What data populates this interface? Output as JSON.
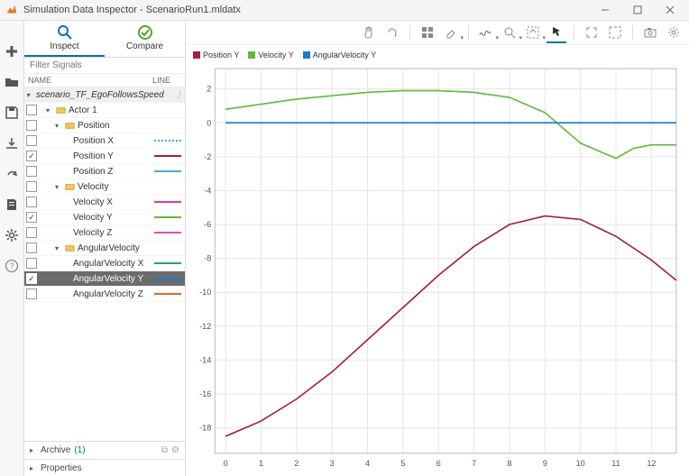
{
  "window": {
    "title": "Simulation Data Inspector - ScenarioRun1.mldatx"
  },
  "tabs": {
    "inspect": "Inspect",
    "compare": "Compare"
  },
  "filter_placeholder": "Filter Signals",
  "columns": {
    "name": "NAME",
    "line": "LINE"
  },
  "scenario": "scenario_TF_EgoFollowsSpeed",
  "actor": "Actor 1",
  "groups": {
    "position": "Position",
    "velocity": "Velocity",
    "angvel": "AngularVelocity"
  },
  "signals": {
    "px": "Position X",
    "py": "Position Y",
    "pz": "Position Z",
    "vx": "Velocity X",
    "vy": "Velocity Y",
    "vz": "Velocity Z",
    "ax": "AngularVelocity X",
    "ay": "AngularVelocity Y",
    "az": "AngularVelocity Z"
  },
  "archive": {
    "label": "Archive",
    "count": "(1)"
  },
  "properties": "Properties",
  "legend": {
    "py": "Position Y",
    "vy": "Velocity Y",
    "ay": "AngularVelocity Y"
  },
  "colors": {
    "py": "#a1203a",
    "vy": "#61b840",
    "ay": "#1f77d4",
    "px": "#4aa8d8",
    "pz": "#4aa8d8",
    "vx": "#c63fc6",
    "vz": "#e04fb8",
    "ax": "#2e9e6e",
    "az": "#e06a2a"
  },
  "chart_data": {
    "type": "line",
    "xlim": [
      -0.3,
      12.7
    ],
    "ylim": [
      -19.5,
      3.2
    ],
    "xticks": [
      0,
      1,
      2,
      3,
      4,
      5,
      6,
      7,
      8,
      9,
      10,
      11,
      12
    ],
    "yticks": [
      2,
      0,
      -2,
      -4,
      -6,
      -8,
      -10,
      -12,
      -14,
      -16,
      -18
    ],
    "series": [
      {
        "name": "Position Y",
        "color": "#a1203a",
        "x": [
          0,
          1,
          2,
          3,
          4,
          5,
          6,
          7,
          8,
          9,
          10,
          11,
          12,
          12.7
        ],
        "y": [
          -18.5,
          -17.6,
          -16.3,
          -14.7,
          -12.8,
          -10.9,
          -9.0,
          -7.3,
          -6.0,
          -5.5,
          -5.7,
          -6.7,
          -8.1,
          -9.3
        ]
      },
      {
        "name": "Velocity Y",
        "color": "#61b840",
        "x": [
          0,
          1,
          2,
          3,
          4,
          5,
          6,
          7,
          8,
          9,
          10,
          11,
          11.5,
          12,
          12.7
        ],
        "y": [
          0.8,
          1.1,
          1.4,
          1.6,
          1.8,
          1.9,
          1.9,
          1.8,
          1.5,
          0.6,
          -1.2,
          -2.1,
          -1.5,
          -1.3,
          -1.3
        ]
      },
      {
        "name": "AngularVelocity Y",
        "color": "#1f77d4",
        "x": [
          0,
          12.7
        ],
        "y": [
          0,
          0
        ]
      }
    ]
  }
}
